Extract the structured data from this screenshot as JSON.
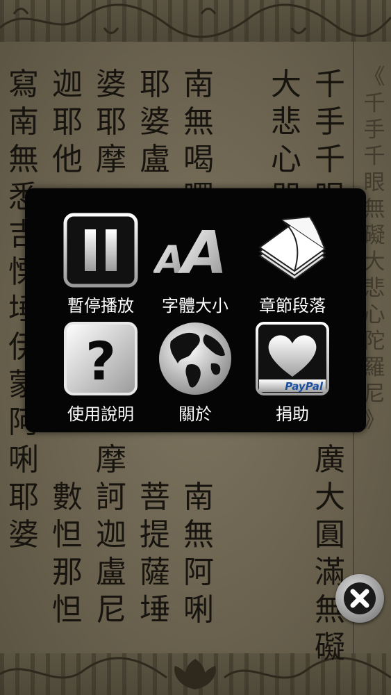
{
  "title_text": "《千手千眼無礙大悲心陀羅尼》",
  "columns": [
    {
      "chars": "千手千眼"
    },
    {
      "chars": "大悲心咒"
    },
    {
      "chars": "南無喝囉"
    },
    {
      "chars": "耶婆盧"
    },
    {
      "chars": "婆耶摩"
    },
    {
      "chars": "迦耶他"
    },
    {
      "chars": "寫南無悉吉慄埵伊蒙阿唎耶婆"
    }
  ],
  "lower_columns": [
    {
      "chars": "廣大圓滿無礙"
    },
    {
      "chars": "南無阿唎"
    },
    {
      "chars": "菩提薩埵"
    },
    {
      "chars": "摩訶迦盧尼"
    },
    {
      "chars": "數怛那怛"
    }
  ],
  "menu": {
    "items": [
      {
        "label": "暫停播放",
        "icon": "pause-icon"
      },
      {
        "label": "字體大小",
        "icon": "font-size-icon"
      },
      {
        "label": "章節段落",
        "icon": "book-icon"
      },
      {
        "label": "使用說明",
        "icon": "help-icon"
      },
      {
        "label": "關於",
        "icon": "globe-icon"
      },
      {
        "label": "捐助",
        "icon": "heart-paypal-icon"
      }
    ],
    "paypal_text": "PayPal"
  },
  "close_icon": "close-icon"
}
